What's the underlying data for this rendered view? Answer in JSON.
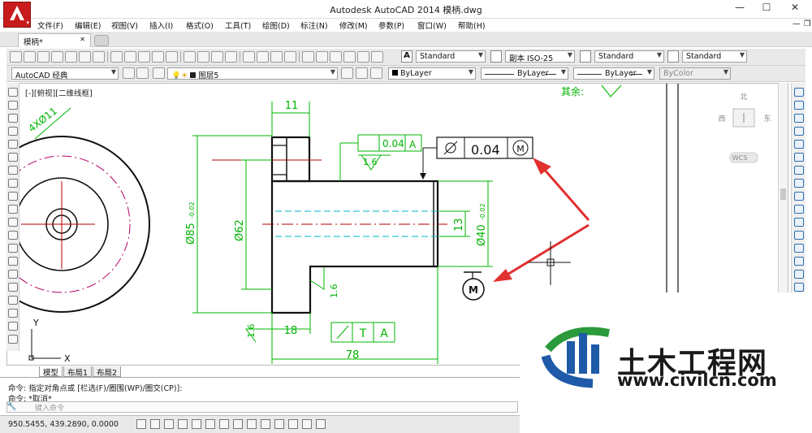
{
  "window": {
    "title": "Autodesk AutoCAD 2014    模柄.dwg",
    "controls": [
      "—",
      "☐",
      "✕"
    ]
  },
  "menu": [
    "文件(F)",
    "编辑(E)",
    "视图(V)",
    "插入(I)",
    "格式(O)",
    "工具(T)",
    "绘图(D)",
    "标注(N)",
    "修改(M)",
    "参数(P)",
    "窗口(W)",
    "帮助(H)"
  ],
  "doc_tab": {
    "label": "模柄*",
    "close": "✕"
  },
  "styles_toolbar": {
    "text_style": "Standard",
    "dim_style": "副本 ISO-25",
    "table_style": "Standard",
    "multileader_style": "Standard"
  },
  "layers_toolbar": {
    "workspace": "AutoCAD 经典",
    "layer": "图层5",
    "color": "ByLayer",
    "linetype": "ByLayer",
    "lineweight": "ByLayer",
    "plotstyle": "ByColor"
  },
  "viewport": {
    "label": "[-][俯视][二维线框]",
    "viewcube": {
      "north": "北",
      "west": "西",
      "east": "东",
      "top": "上",
      "wcs": "WCS"
    },
    "ucs": {
      "x": "X",
      "y": "Y"
    }
  },
  "drawing": {
    "hole_note": "4XØ11",
    "dim_11": "11",
    "dim_dia85": "Ø85",
    "dim_dia85_tol": "-0.02",
    "dim_dia62": "Ø62",
    "dim_dia40": "Ø40",
    "dim_dia40_tol": "-0.02",
    "dim_13": "13",
    "dim_18": "18",
    "dim_78": "78",
    "rough_16_a": "1.6",
    "rough_16_b": "1.6",
    "rough_16_c": "1.6",
    "rest_label": "其余:",
    "fcf_small_tol": "0.04",
    "fcf_small_datum": "A",
    "fcf_big_tol": "0.04",
    "fcf_big_mod": "M",
    "fcf_bottom_a": "T",
    "fcf_bottom_b": "A",
    "datum_symbol": "M"
  },
  "layout_tabs": [
    "模型",
    "布局1",
    "布局2"
  ],
  "command": {
    "line1": "命令: 指定对角点或 [栏选(F)/圈围(WP)/圈交(CP)]:",
    "line2": "命令: *取消*",
    "placeholder": "键入命令"
  },
  "status": {
    "coords": "950.5455, 439.2890, 0.0000"
  },
  "watermark": {
    "title": "土木工程网",
    "url": "www.civilcn.com"
  },
  "colors": {
    "dim": "#00b400",
    "center": "#b40000",
    "hidden": "#00b4c8",
    "arrow": "#e03030",
    "logo_blue": "#1e5aa8",
    "logo_green": "#2a9a3a"
  }
}
